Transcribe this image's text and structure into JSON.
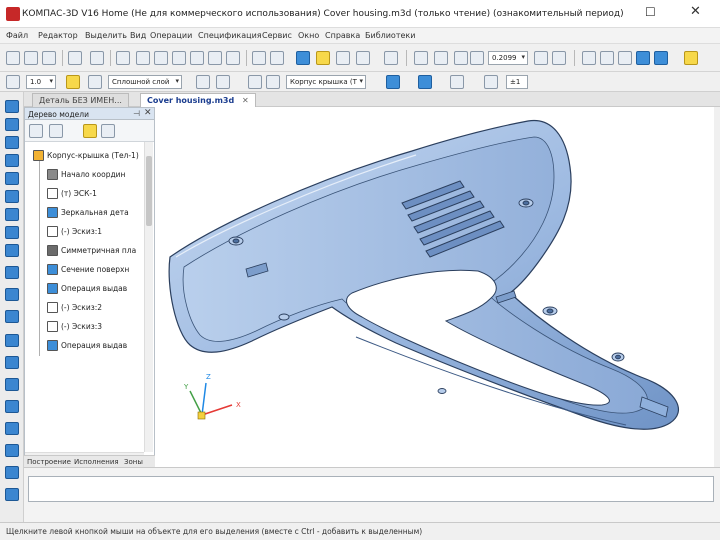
{
  "window": {
    "title": "КОМПАС-3D V16 Home  (Не для коммерческого использования)  Cover housing.m3d (только чтение) (ознакомительный период)",
    "maximize_glyph": "☐",
    "close_glyph": "✕"
  },
  "menu": {
    "items": [
      "Файл",
      "Редактор",
      "Выделить",
      "Вид",
      "Операции",
      "Спецификация",
      "Сервис",
      "Окно",
      "Справка",
      "Библиотеки"
    ]
  },
  "toolbar": {
    "zoom_value": "0.2099",
    "zoom_step": "±1",
    "step_value": "1.0"
  },
  "toolbar2": {
    "style_combo": "Сплошной слой",
    "orient_combo": "Корпус крышка (Т",
    "step_combo": "1.0"
  },
  "tabs": [
    {
      "label": "Деталь БЕЗ ИМЕН...",
      "active": false
    },
    {
      "label": "Cover housing.m3d",
      "active": true
    }
  ],
  "tree": {
    "title": "Дерево модели",
    "items": [
      {
        "label": "Корпус-крышка (Тел-1)",
        "icon": "part-icon",
        "indent": 0
      },
      {
        "label": "Начало координ",
        "icon": "origin-icon",
        "indent": 1
      },
      {
        "label": "(т) ЭСК-1",
        "icon": "sketch-icon",
        "indent": 1
      },
      {
        "label": "Зеркальная дета",
        "icon": "mirror-icon",
        "indent": 1
      },
      {
        "label": "(-) Эскиз:1",
        "icon": "sketch-icon",
        "indent": 1
      },
      {
        "label": "Симметричная пла",
        "icon": "plane-icon",
        "indent": 1
      },
      {
        "label": "Сечение поверхн",
        "icon": "section-icon",
        "indent": 1
      },
      {
        "label": "Операция выдав",
        "icon": "extrude-icon",
        "indent": 1
      },
      {
        "label": "(-) Эскиз:2",
        "icon": "sketch-icon",
        "indent": 1
      },
      {
        "label": "(-) Эскиз:3",
        "icon": "sketch-icon",
        "indent": 1
      },
      {
        "label": "Операция выдав",
        "icon": "extrude-icon",
        "indent": 1
      }
    ]
  },
  "panel_tabs": [
    "Построение",
    "Исполнения",
    "Зоны"
  ],
  "status": {
    "text": "Щелкните левой кнопкой мыши на объекте для его выделения (вместе с Ctrl - добавить к выделенным)"
  },
  "axes": {
    "x": "X",
    "y": "Y",
    "z": "Z"
  },
  "colors": {
    "part_fill": "#a8c3e6",
    "part_shadow": "#5f86bd",
    "part_edge": "#2b3f5e",
    "accent": "#3d8ed8"
  }
}
